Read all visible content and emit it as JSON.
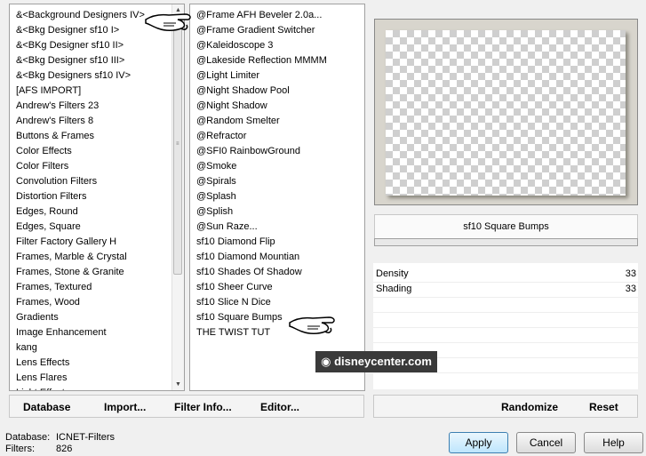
{
  "left_list": {
    "items": [
      "&<Background Designers IV>",
      "&<Bkg Designer sf10 I>",
      "&<BKg Designer sf10 II>",
      "&<Bkg Designer sf10 III>",
      "&<Bkg Designers sf10 IV>",
      "[AFS IMPORT]",
      "Andrew's Filters 23",
      "Andrew's Filters 8",
      "Buttons & Frames",
      "Color Effects",
      "Color Filters",
      "Convolution Filters",
      "Distortion Filters",
      "Edges, Round",
      "Edges, Square",
      "Filter Factory Gallery H",
      "Frames, Marble & Crystal",
      "Frames, Stone & Granite",
      "Frames, Textured",
      "Frames, Wood",
      "Gradients",
      "Image Enhancement",
      "kang",
      "Lens Effects",
      "Lens Flares",
      "Light Effects"
    ]
  },
  "mid_list": {
    "items": [
      "@Frame AFH Beveler 2.0a...",
      "@Frame Gradient Switcher",
      "@Kaleidoscope 3",
      "@Lakeside Reflection MMMM",
      "@Light Limiter",
      "@Night Shadow Pool",
      "@Night Shadow",
      "@Random Smelter",
      "@Refractor",
      "@SFI0 RainbowGround",
      "@Smoke",
      "@Spirals",
      "@Splash",
      "@Splish",
      "@Sun Raze...",
      "sf10 Diamond Flip",
      "sf10 Diamond Mountian",
      "sf10 Shades Of Shadow",
      "sf10 Sheer Curve",
      "sf10 Slice N Dice",
      "sf10 Square Bumps",
      "THE TWIST TUT"
    ]
  },
  "filter_name": "sf10 Square Bumps",
  "params": [
    {
      "label": "Density",
      "value": "33"
    },
    {
      "label": "Shading",
      "value": "33"
    }
  ],
  "bottom_left_buttons": [
    "Database",
    "Import...",
    "Filter Info...",
    "Editor..."
  ],
  "bottom_right_buttons": [
    "Randomize",
    "Reset"
  ],
  "status": {
    "database_label": "Database:",
    "database_value": "ICNET-Filters",
    "filters_label": "Filters:",
    "filters_value": "826"
  },
  "dialog_buttons": {
    "apply": "Apply",
    "cancel": "Cancel",
    "help": "Help"
  },
  "watermark": "disneycenter.com"
}
